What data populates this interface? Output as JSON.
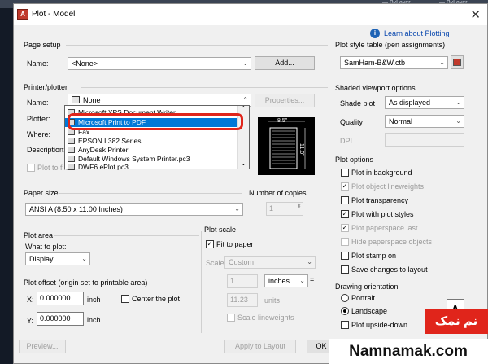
{
  "background": {
    "bylayer_left": "— ByLayer",
    "bylayer_right": "— ByLayer"
  },
  "dialog": {
    "app_icon_letter": "A",
    "title": "Plot - Model",
    "help_link": "Learn about Plotting",
    "page_setup": {
      "section_title": "Page setup",
      "name_label": "Name:",
      "name_value": "<None>",
      "add_button": "Add..."
    },
    "printer": {
      "section_title": "Printer/plotter",
      "name_label": "Name:",
      "name_value": "None",
      "properties_button": "Properties...",
      "plotter_label": "Plotter:",
      "where_label": "Where:",
      "description_label": "Description:",
      "plot_to_file_label": "Plot to file",
      "dropdown_items": [
        "Microsoft XPS Document Writer",
        "Microsoft Print to PDF",
        "Fax",
        "EPSON L382 Series",
        "AnyDesk Printer",
        "Default Windows System Printer.pc3",
        "DWF6 ePlot.pc3"
      ],
      "selected_index": 1,
      "preview_width": "8.5\"",
      "preview_height": "11.0\""
    },
    "paper_size": {
      "section_title": "Paper size",
      "value": "ANSI A (8.50 x 11.00 Inches)"
    },
    "copies": {
      "section_title": "Number of copies",
      "value": "1"
    },
    "plot_area": {
      "section_title": "Plot area",
      "what_label": "What to plot:",
      "value": "Display"
    },
    "plot_scale": {
      "section_title": "Plot scale",
      "fit_label": "Fit to paper",
      "fit_checked": true,
      "scale_label": "Scale:",
      "scale_value": "Custom",
      "num_value": "1",
      "unit_value": "inches",
      "equals": "=",
      "units_value": "11.23",
      "units_label": "units",
      "lineweights_label": "Scale lineweights"
    },
    "plot_offset": {
      "section_title": "Plot offset (origin set to printable area)",
      "x_label": "X:",
      "x_value": "0.000000",
      "x_unit": "inch",
      "y_label": "Y:",
      "y_value": "0.000000",
      "y_unit": "inch",
      "center_label": "Center the plot"
    },
    "plot_style_table": {
      "section_title": "Plot style table (pen assignments)",
      "value": "SamHam-B&W.ctb"
    },
    "shaded_viewport": {
      "section_title": "Shaded viewport options",
      "shade_label": "Shade plot",
      "shade_value": "As displayed",
      "quality_label": "Quality",
      "quality_value": "Normal",
      "dpi_label": "DPI"
    },
    "plot_options": {
      "section_title": "Plot options",
      "items": [
        {
          "label": "Plot in background",
          "checked": false,
          "enabled": true
        },
        {
          "label": "Plot object lineweights",
          "checked": true,
          "enabled": false
        },
        {
          "label": "Plot transparency",
          "checked": false,
          "enabled": true
        },
        {
          "label": "Plot with plot styles",
          "checked": true,
          "enabled": true
        },
        {
          "label": "Plot paperspace last",
          "checked": true,
          "enabled": false
        },
        {
          "label": "Hide paperspace objects",
          "checked": false,
          "enabled": false
        },
        {
          "label": "Plot stamp on",
          "checked": false,
          "enabled": true
        },
        {
          "label": "Save changes to layout",
          "checked": false,
          "enabled": true
        }
      ]
    },
    "orientation": {
      "section_title": "Drawing orientation",
      "portrait": "Portrait",
      "landscape": "Landscape",
      "upside_down": "Plot upside-down",
      "selected": "Landscape"
    },
    "footer": {
      "preview_button": "Preview...",
      "apply_button": "Apply to Layout",
      "ok_button": "OK"
    }
  },
  "watermark": {
    "badge": "نم نمک",
    "site": "Namnamak.com"
  },
  "colors": {
    "highlight": "#0078d7",
    "annotation_ring": "#e0251b",
    "link": "#0645ad"
  }
}
